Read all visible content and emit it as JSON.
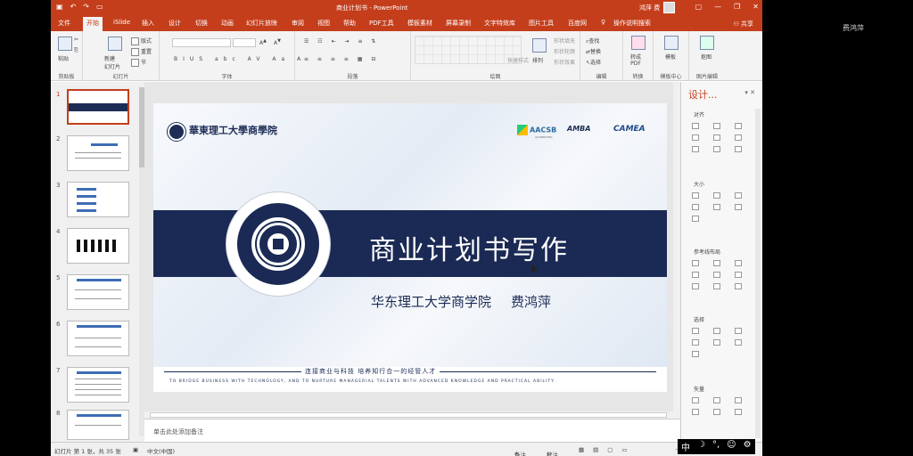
{
  "overlay_name": "费鸿萍",
  "window": {
    "doc_title": "商业计划书 - PowerPoint",
    "user_name": "鸿萍 费",
    "qa_icons": [
      "save-icon",
      "undo-icon",
      "redo-icon",
      "present-icon"
    ]
  },
  "tabs": [
    {
      "label": "文件"
    },
    {
      "label": "开始"
    },
    {
      "label": "iSlide"
    },
    {
      "label": "插入"
    },
    {
      "label": "设计"
    },
    {
      "label": "切换"
    },
    {
      "label": "动画"
    },
    {
      "label": "幻灯片放映"
    },
    {
      "label": "审阅"
    },
    {
      "label": "视图"
    },
    {
      "label": "帮助"
    },
    {
      "label": "PDF工具"
    },
    {
      "label": "模板素材"
    },
    {
      "label": "屏幕录制"
    },
    {
      "label": "文字特效库"
    },
    {
      "label": "图片工具"
    },
    {
      "label": "百度网"
    },
    {
      "label": "操作说明搜索"
    }
  ],
  "share_label": "共享",
  "ribbon": {
    "groups": {
      "clipboard": "剪贴板",
      "slides": "幻灯片",
      "font": "字体",
      "paragraph": "段落",
      "drawing": "绘图",
      "editing": "编辑",
      "convert": "转换",
      "template_center": "模板中心",
      "image_editing": "图片编辑"
    },
    "paste": "粘贴",
    "new_slide": "新建\n幻灯片",
    "layout": "版式",
    "reset": "重置",
    "section": "节",
    "arrange": "排列",
    "quick_styles": "快速样式",
    "shape_fill": "形状填充",
    "shape_outline": "形状轮廓",
    "shape_effects": "形状效果",
    "find": "查找",
    "replace": "替换",
    "select": "选择",
    "to_pdf": "转成\nPDF",
    "template": "模板",
    "cutout": "抠图"
  },
  "slides": [
    {
      "num": "1"
    },
    {
      "num": "2"
    },
    {
      "num": "3"
    },
    {
      "num": "4"
    },
    {
      "num": "5"
    },
    {
      "num": "6"
    },
    {
      "num": "7"
    },
    {
      "num": "8"
    }
  ],
  "slide": {
    "header_cn": "華東理工大學商學院",
    "accreditations": [
      "AACSB",
      "AMBA",
      "CAMEA"
    ],
    "aacsb_sub": "ACCREDITED",
    "title": "商业计划书写作",
    "subtitle": "华东理工大学商学院",
    "author": "费鸿萍",
    "motto_cn": "连接商业与科技    培养知行合一的经管人才",
    "motto_en": "TO BRIDGE BUSINESS WITH TECHNOLOGY, AND TO NURTURE MANAGERIAL TALENTS WITH ADVANCED KNOWLEDGE AND PRACTICAL ABILITY."
  },
  "notes_placeholder": "单击此处添加备注",
  "design_pane": {
    "title": "设计...",
    "sections": [
      "对齐",
      "大小",
      "参考线布局",
      "选择",
      "矢量"
    ]
  },
  "statusbar": {
    "slide_info": "幻灯片 第 1 张，共 35 张",
    "language": "中文(中国)",
    "notes_btn": "备注",
    "comments_btn": "批注"
  },
  "ime": {
    "mode": "中"
  }
}
